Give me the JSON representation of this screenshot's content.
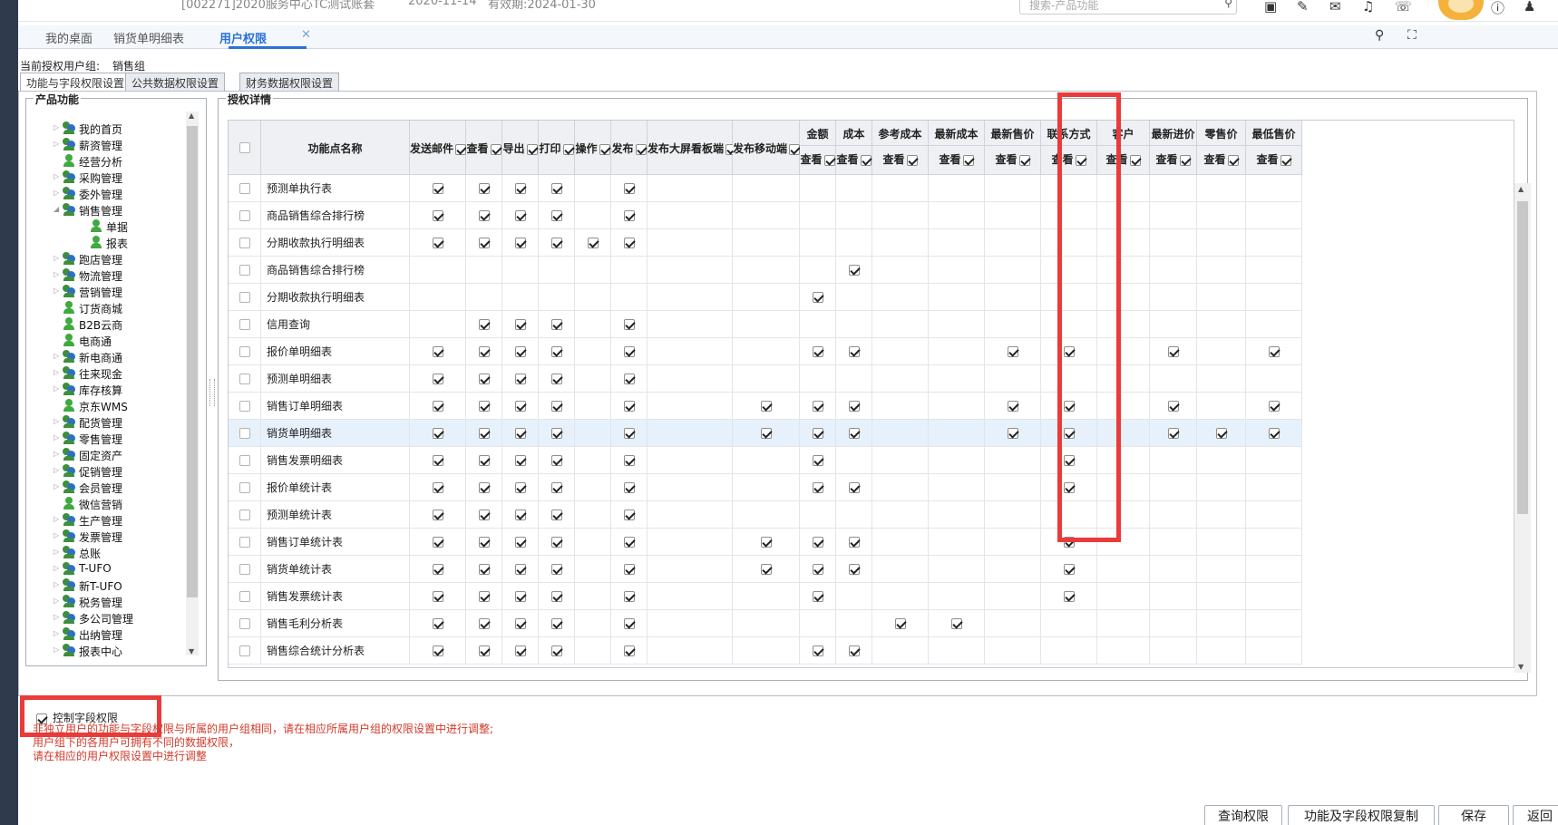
{
  "top": {
    "account": "[002271]2020服务中心TC测试账套",
    "date": "2020-11-14",
    "valid": "有效期:2024-01-30",
    "search_placeholder": "搜索-产品功能"
  },
  "tabs": [
    {
      "label": "我的桌面"
    },
    {
      "label": "销货单明细表"
    },
    {
      "label": "用户权限"
    }
  ],
  "current_group": {
    "label": "当前授权用户组:",
    "value": "销售组"
  },
  "subtabs": [
    "功能与字段权限设置",
    "公共数据权限设置",
    "财务数据权限设置"
  ],
  "tree": {
    "title": "产品功能",
    "items": [
      {
        "label": "我的首页",
        "icon": "group",
        "level": 0,
        "arrow": "right"
      },
      {
        "label": "薪资管理",
        "icon": "group",
        "level": 0,
        "arrow": "right"
      },
      {
        "label": "经营分析",
        "icon": "single",
        "level": 0,
        "arrow": ""
      },
      {
        "label": "采购管理",
        "icon": "group",
        "level": 0,
        "arrow": "right"
      },
      {
        "label": "委外管理",
        "icon": "group",
        "level": 0,
        "arrow": "right"
      },
      {
        "label": "销售管理",
        "icon": "group",
        "level": 0,
        "arrow": "down"
      },
      {
        "label": "单据",
        "icon": "single",
        "level": 1,
        "arrow": ""
      },
      {
        "label": "报表",
        "icon": "single",
        "level": 1,
        "arrow": ""
      },
      {
        "label": "跑店管理",
        "icon": "group",
        "level": 0,
        "arrow": "right"
      },
      {
        "label": "物流管理",
        "icon": "group",
        "level": 0,
        "arrow": "right"
      },
      {
        "label": "营销管理",
        "icon": "group",
        "level": 0,
        "arrow": "right"
      },
      {
        "label": "订货商城",
        "icon": "single",
        "level": 0,
        "arrow": ""
      },
      {
        "label": "B2B云商",
        "icon": "single",
        "level": 0,
        "arrow": ""
      },
      {
        "label": "电商通",
        "icon": "single",
        "level": 0,
        "arrow": ""
      },
      {
        "label": "新电商通",
        "icon": "group",
        "level": 0,
        "arrow": "right"
      },
      {
        "label": "往来现金",
        "icon": "group",
        "level": 0,
        "arrow": "right"
      },
      {
        "label": "库存核算",
        "icon": "group",
        "level": 0,
        "arrow": "right"
      },
      {
        "label": "京东WMS",
        "icon": "single",
        "level": 0,
        "arrow": ""
      },
      {
        "label": "配货管理",
        "icon": "group",
        "level": 0,
        "arrow": "right"
      },
      {
        "label": "零售管理",
        "icon": "group",
        "level": 0,
        "arrow": "right"
      },
      {
        "label": "固定资产",
        "icon": "group",
        "level": 0,
        "arrow": "right"
      },
      {
        "label": "促销管理",
        "icon": "group",
        "level": 0,
        "arrow": "right"
      },
      {
        "label": "会员管理",
        "icon": "group",
        "level": 0,
        "arrow": "right"
      },
      {
        "label": "微信营销",
        "icon": "single",
        "level": 0,
        "arrow": ""
      },
      {
        "label": "生产管理",
        "icon": "group",
        "level": 0,
        "arrow": "right"
      },
      {
        "label": "发票管理",
        "icon": "group",
        "level": 0,
        "arrow": "right"
      },
      {
        "label": "总账",
        "icon": "group",
        "level": 0,
        "arrow": "right"
      },
      {
        "label": "T-UFO",
        "icon": "group",
        "level": 0,
        "arrow": "right"
      },
      {
        "label": "新T-UFO",
        "icon": "group",
        "level": 0,
        "arrow": "right"
      },
      {
        "label": "税务管理",
        "icon": "group",
        "level": 0,
        "arrow": "right"
      },
      {
        "label": "多公司管理",
        "icon": "group",
        "level": 0,
        "arrow": "right"
      },
      {
        "label": "出纳管理",
        "icon": "group",
        "level": 0,
        "arrow": "right"
      },
      {
        "label": "报表中心",
        "icon": "group",
        "level": 0,
        "arrow": "right"
      }
    ]
  },
  "grid": {
    "title": "授权详情",
    "name_header": "功能点名称",
    "view_label": "查看",
    "columns": [
      {
        "label": "发送邮件"
      },
      {
        "label": "查看"
      },
      {
        "label": "导出"
      },
      {
        "label": "打印"
      },
      {
        "label": "操作"
      },
      {
        "label": "发布"
      },
      {
        "label": "发布大屏看板端"
      },
      {
        "label": "发布移动端"
      },
      {
        "label": "金额"
      },
      {
        "label": "成本"
      },
      {
        "label": "参考成本"
      },
      {
        "label": "最新成本"
      },
      {
        "label": "最新售价"
      },
      {
        "label": "联系方式"
      },
      {
        "label": "客户"
      },
      {
        "label": "最新进价"
      },
      {
        "label": "零售价"
      },
      {
        "label": "最低售价"
      }
    ],
    "rows": [
      {
        "name": "预测单执行表",
        "checks": [
          1,
          1,
          1,
          1,
          0,
          1,
          0,
          0,
          0,
          0,
          0,
          0,
          0,
          0,
          0,
          0,
          0,
          0
        ]
      },
      {
        "name": "商品销售综合排行榜",
        "checks": [
          1,
          1,
          1,
          1,
          0,
          1,
          0,
          0,
          0,
          0,
          0,
          0,
          0,
          0,
          0,
          0,
          0,
          0
        ]
      },
      {
        "name": "分期收款执行明细表",
        "checks": [
          1,
          1,
          1,
          1,
          1,
          1,
          0,
          0,
          0,
          0,
          0,
          0,
          0,
          0,
          0,
          0,
          0,
          0
        ]
      },
      {
        "name": "商品销售综合排行榜",
        "checks": [
          0,
          0,
          0,
          0,
          0,
          0,
          0,
          0,
          0,
          1,
          0,
          0,
          0,
          0,
          0,
          0,
          0,
          0
        ]
      },
      {
        "name": "分期收款执行明细表",
        "checks": [
          0,
          0,
          0,
          0,
          0,
          0,
          0,
          0,
          1,
          0,
          0,
          0,
          0,
          0,
          0,
          0,
          0,
          0
        ]
      },
      {
        "name": "信用查询",
        "checks": [
          0,
          1,
          1,
          1,
          0,
          1,
          0,
          0,
          0,
          0,
          0,
          0,
          0,
          0,
          0,
          0,
          0,
          0
        ]
      },
      {
        "name": "报价单明细表",
        "checks": [
          1,
          1,
          1,
          1,
          0,
          1,
          0,
          0,
          1,
          1,
          0,
          0,
          1,
          1,
          0,
          1,
          0,
          1
        ]
      },
      {
        "name": "预测单明细表",
        "checks": [
          1,
          1,
          1,
          1,
          0,
          1,
          0,
          0,
          0,
          0,
          0,
          0,
          0,
          0,
          0,
          0,
          0,
          0
        ]
      },
      {
        "name": "销售订单明细表",
        "checks": [
          1,
          1,
          1,
          1,
          0,
          1,
          0,
          1,
          1,
          1,
          0,
          0,
          1,
          1,
          0,
          1,
          0,
          1
        ]
      },
      {
        "name": "销货单明细表",
        "checks": [
          1,
          1,
          1,
          1,
          0,
          1,
          0,
          1,
          1,
          1,
          0,
          0,
          1,
          1,
          0,
          1,
          1,
          1
        ],
        "highlight": true
      },
      {
        "name": "销售发票明细表",
        "checks": [
          1,
          1,
          1,
          1,
          0,
          1,
          0,
          0,
          1,
          0,
          0,
          0,
          0,
          1,
          0,
          0,
          0,
          0
        ]
      },
      {
        "name": "报价单统计表",
        "checks": [
          1,
          1,
          1,
          1,
          0,
          1,
          0,
          0,
          1,
          1,
          0,
          0,
          0,
          1,
          0,
          0,
          0,
          0
        ]
      },
      {
        "name": "预测单统计表",
        "checks": [
          1,
          1,
          1,
          1,
          0,
          1,
          0,
          0,
          0,
          0,
          0,
          0,
          0,
          0,
          0,
          0,
          0,
          0
        ]
      },
      {
        "name": "销售订单统计表",
        "checks": [
          1,
          1,
          1,
          1,
          0,
          1,
          0,
          1,
          1,
          1,
          0,
          0,
          0,
          1,
          0,
          0,
          0,
          0
        ]
      },
      {
        "name": "销货单统计表",
        "checks": [
          1,
          1,
          1,
          1,
          0,
          1,
          0,
          1,
          1,
          1,
          0,
          0,
          0,
          1,
          0,
          0,
          0,
          0
        ]
      },
      {
        "name": "销售发票统计表",
        "checks": [
          1,
          1,
          1,
          1,
          0,
          1,
          0,
          0,
          1,
          0,
          0,
          0,
          0,
          1,
          0,
          0,
          0,
          0
        ]
      },
      {
        "name": "销售毛利分析表",
        "checks": [
          1,
          1,
          1,
          1,
          0,
          1,
          0,
          0,
          0,
          0,
          1,
          1,
          0,
          0,
          0,
          0,
          0,
          0
        ]
      },
      {
        "name": "销售综合统计分析表",
        "checks": [
          1,
          1,
          1,
          1,
          0,
          1,
          0,
          0,
          1,
          1,
          0,
          0,
          0,
          0,
          0,
          0,
          0,
          0
        ]
      }
    ]
  },
  "control": {
    "label": "控制字段权限",
    "checked": true
  },
  "notes": [
    "非独立用户的功能与字段权限与所属的用户组相同，请在相应所属用户组的权限设置中进行调整;",
    "用户组下的各用户可拥有不同的数据权限，",
    "请在相应的用户权限设置中进行调整"
  ],
  "buttons": [
    "查询权限",
    "功能及字段权限复制",
    "保存",
    "返回"
  ],
  "colors": {
    "accent": "#2a72d4",
    "highlight_box": "#ea3b3b",
    "note_text": "#d23a2a"
  }
}
